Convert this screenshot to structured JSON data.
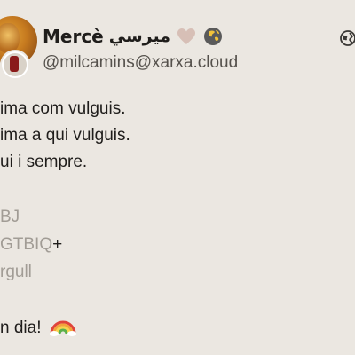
{
  "author": {
    "display_name": "Mercè",
    "rtl_name": "ميرسي",
    "handle": "@milcamins@xarxa.cloud",
    "emojis": [
      "heart-icon",
      "globe-emoji-icon"
    ]
  },
  "visibility_icon": "globe-icon",
  "post": {
    "lines": [
      "ima com vulguis.",
      "ima a qui vulguis.",
      "ui i sempre."
    ],
    "tags": {
      "line1": "BJ",
      "line2_prefix": "GTBIQ",
      "line2_suffix": "+",
      "line3": "rgull"
    },
    "closing": "n dia!",
    "closing_emoji": "rainbow-icon"
  },
  "colors": {
    "background": "#ebe7e1",
    "text": "#1f1d1b",
    "muted": "#a19c95",
    "handle": "#55514c"
  }
}
